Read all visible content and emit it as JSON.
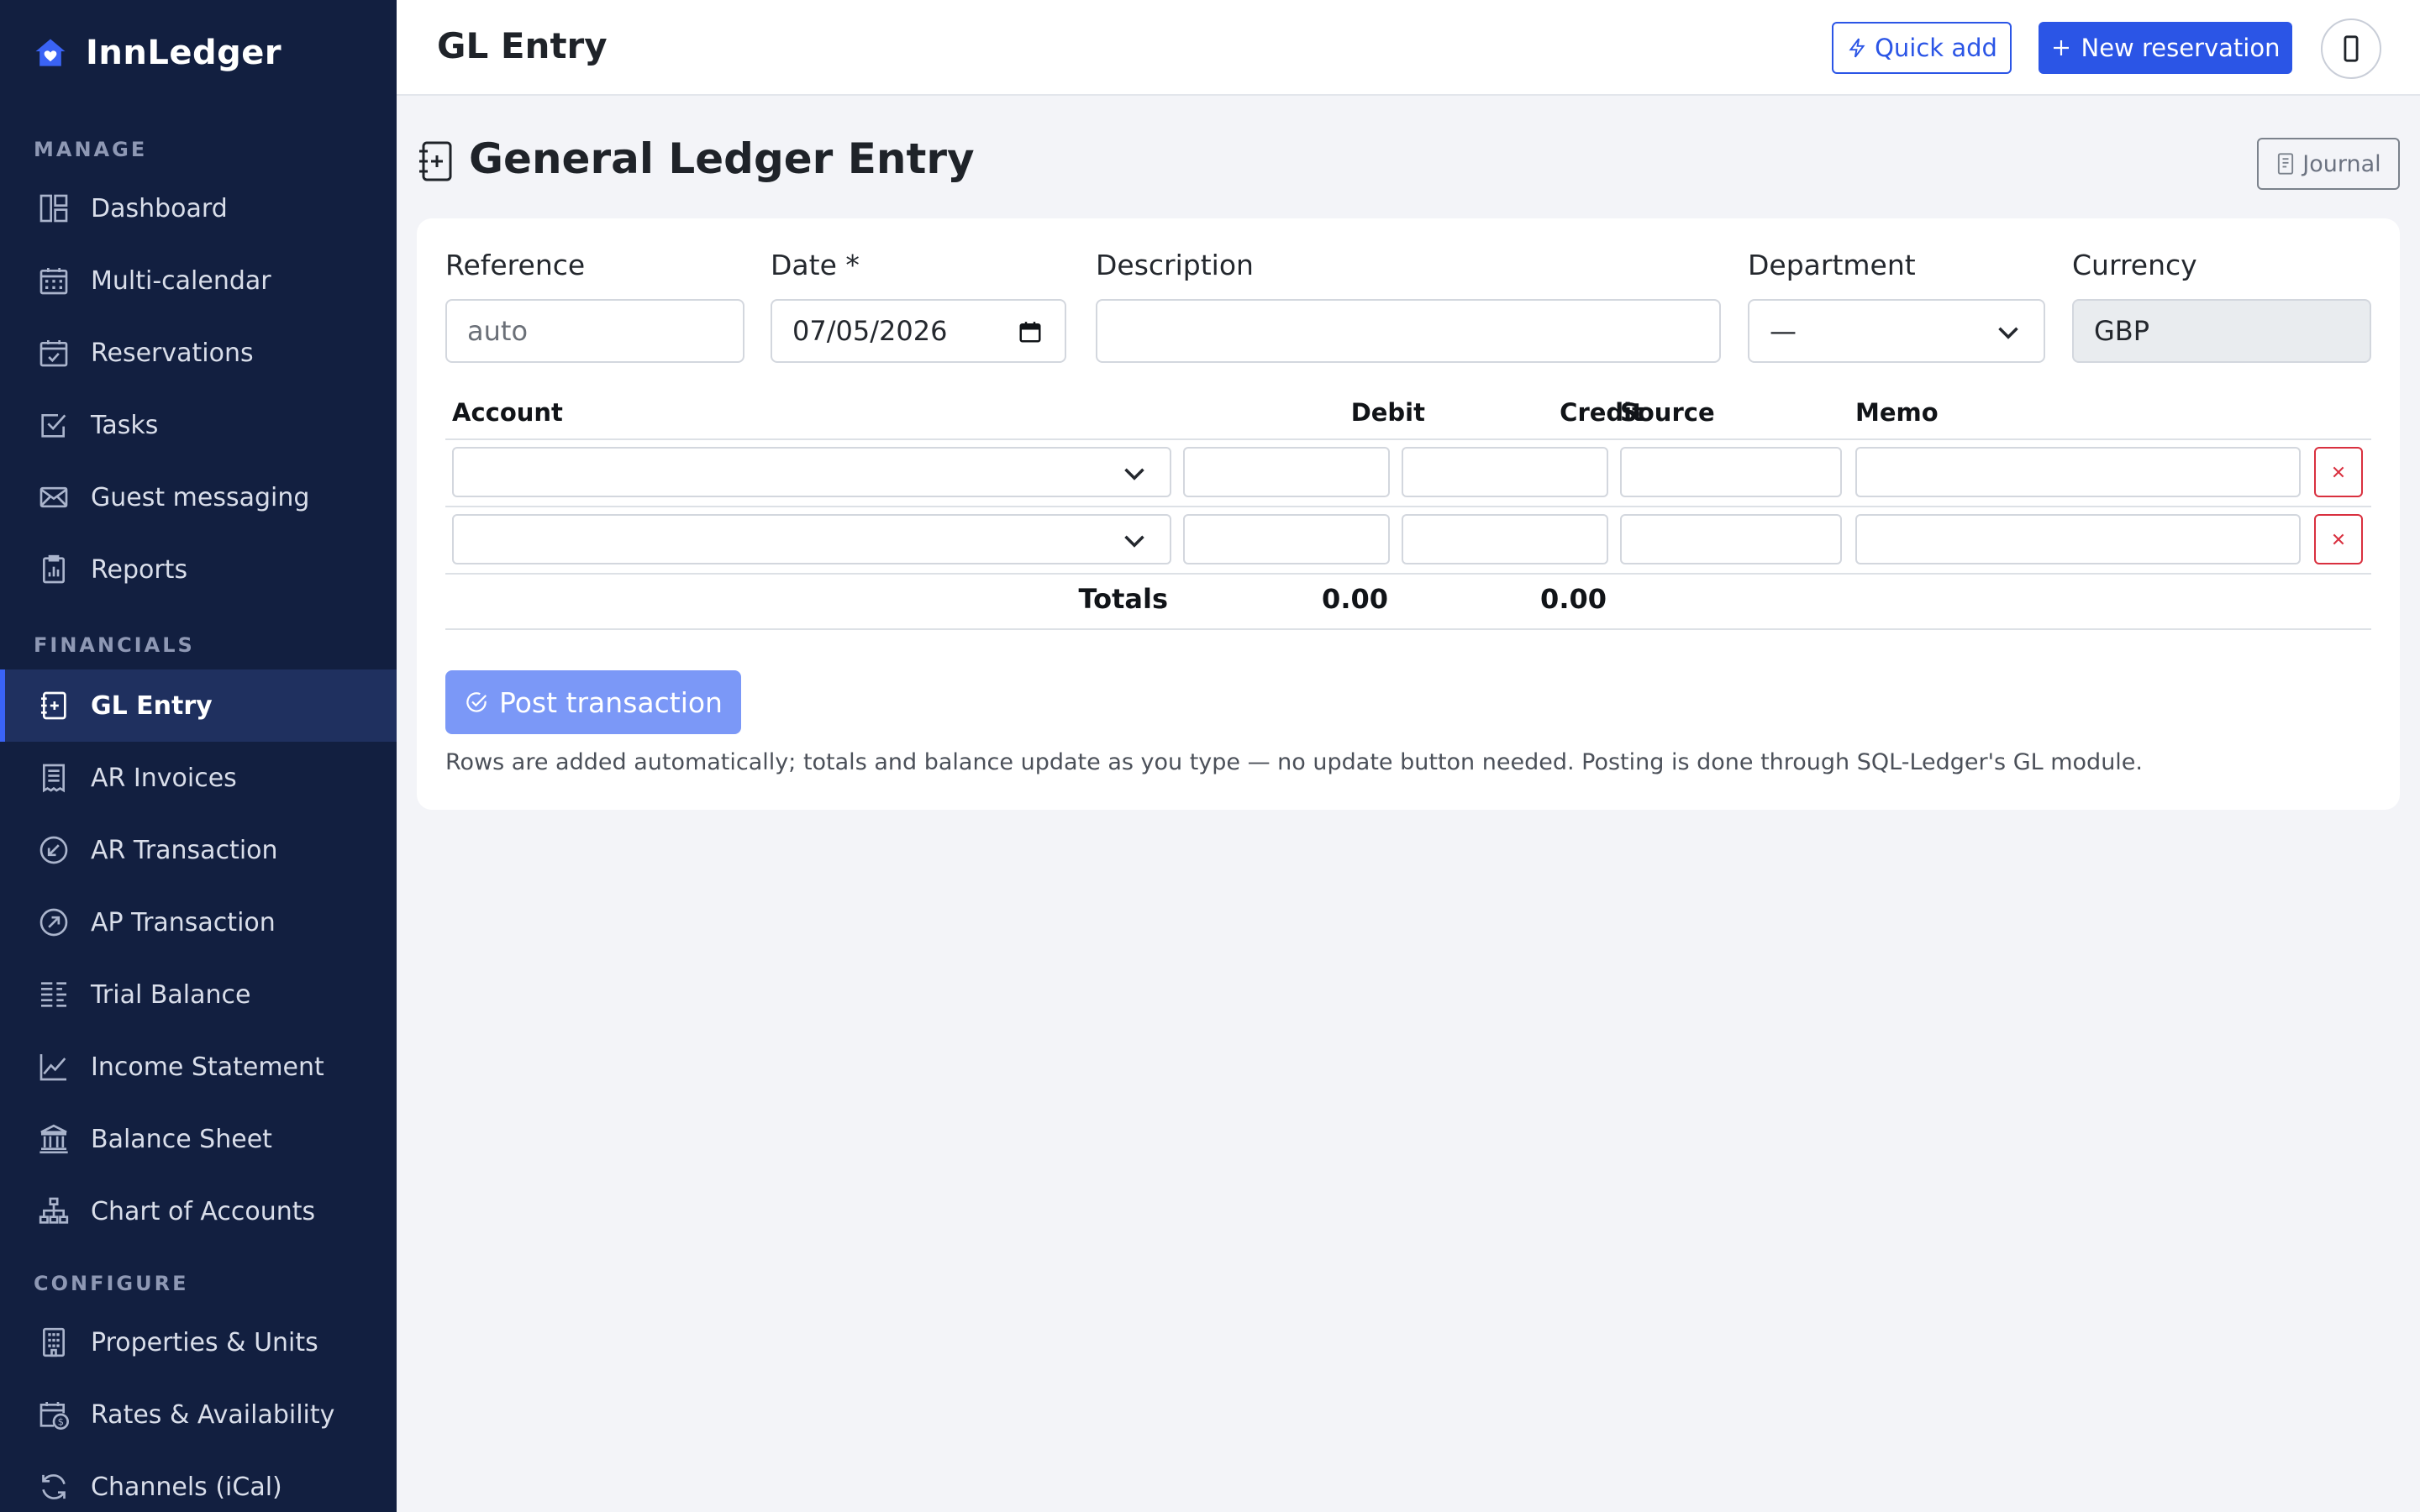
{
  "app": {
    "brand": "InnLedger"
  },
  "sidebar": {
    "sections": {
      "manage": "MANAGE",
      "financials": "FINANCIALS",
      "configure": "CONFIGURE"
    },
    "manage_items": [
      {
        "label": "Dashboard",
        "icon": "dashboard-icon"
      },
      {
        "label": "Multi-calendar",
        "icon": "calendar-grid-icon"
      },
      {
        "label": "Reservations",
        "icon": "calendar-check-icon"
      },
      {
        "label": "Tasks",
        "icon": "checkbox-icon"
      },
      {
        "label": "Guest messaging",
        "icon": "envelope-icon"
      },
      {
        "label": "Reports",
        "icon": "clipboard-chart-icon"
      }
    ],
    "financial_items": [
      {
        "label": "GL Entry",
        "icon": "journal-plus-icon",
        "active": true
      },
      {
        "label": "AR Invoices",
        "icon": "receipt-icon"
      },
      {
        "label": "AR Transaction",
        "icon": "arrow-down-left-circle-icon"
      },
      {
        "label": "AP Transaction",
        "icon": "arrow-up-right-circle-icon"
      },
      {
        "label": "Trial Balance",
        "icon": "list-columns-icon"
      },
      {
        "label": "Income Statement",
        "icon": "graph-up-icon"
      },
      {
        "label": "Balance Sheet",
        "icon": "bank-icon"
      },
      {
        "label": "Chart of Accounts",
        "icon": "diagram-icon"
      }
    ],
    "configure_items": [
      {
        "label": "Properties & Units",
        "icon": "building-icon"
      },
      {
        "label": "Rates & Availability",
        "icon": "calendar-dollar-icon"
      },
      {
        "label": "Channels (iCal)",
        "icon": "sync-icon"
      }
    ]
  },
  "topbar": {
    "title": "GL Entry",
    "quick_add": "Quick add",
    "new_reservation": "New reservation"
  },
  "page": {
    "heading": "General Ledger Entry",
    "journal_button": "Journal"
  },
  "form": {
    "reference": {
      "label": "Reference",
      "placeholder": "auto"
    },
    "date": {
      "label": "Date *",
      "value": "07/05/2026"
    },
    "description": {
      "label": "Description",
      "value": ""
    },
    "department": {
      "label": "Department",
      "value": "—"
    },
    "currency": {
      "label": "Currency",
      "value": "GBP"
    }
  },
  "table": {
    "columns": {
      "account": "Account",
      "debit": "Debit",
      "credit": "Credit",
      "source": "Source",
      "memo": "Memo"
    },
    "rows": [
      {
        "account": "",
        "debit": "",
        "credit": "",
        "source": "",
        "memo": ""
      },
      {
        "account": "",
        "debit": "",
        "credit": "",
        "source": "",
        "memo": ""
      }
    ],
    "totals_label": "Totals",
    "total_debit": "0.00",
    "total_credit": "0.00"
  },
  "actions": {
    "post": "Post transaction",
    "helper": "Rows are added automatically; totals and balance update as you type — no update button needed. Posting is done through SQL-Ledger's GL module."
  },
  "colors": {
    "sidebar_bg": "#121f40",
    "sidebar_active": "#1f305f",
    "accent": "#2b55e6",
    "danger": "#d9303f",
    "post_button": "#7b98f7"
  }
}
